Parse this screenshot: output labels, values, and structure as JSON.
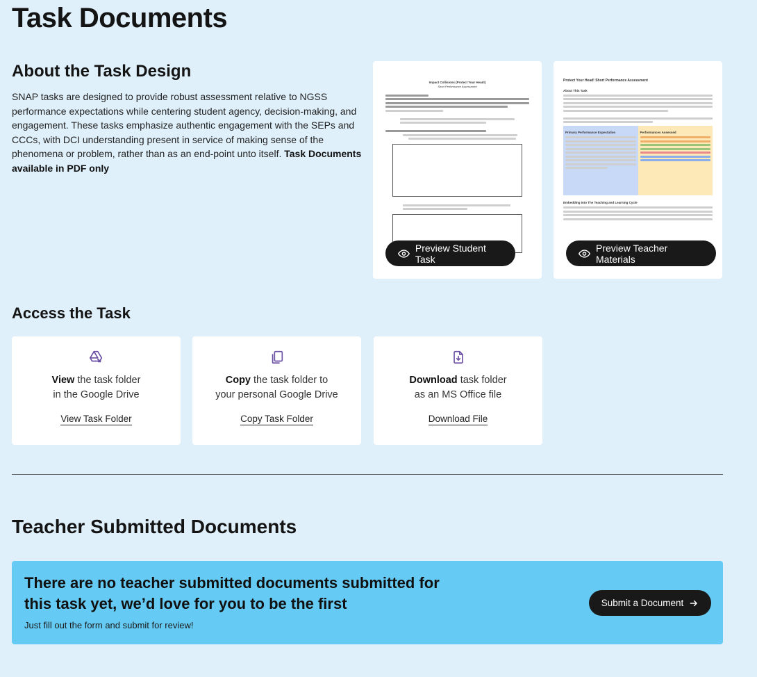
{
  "page": {
    "title": "Task Documents"
  },
  "about": {
    "title": "About the Task Design",
    "body": "SNAP tasks are designed to provide robust assessment relative to NGSS performance expectations while centering student agency, decision-making, and engagement. These tasks emphasize authentic engagement with the SEPs and CCCs, with DCI understanding present in service of making sense of the phenomena or problem, rather than as an end-point unto itself. ",
    "emphasis": "Task Documents available in PDF only"
  },
  "previews": {
    "student": {
      "doc_title": "Impact Collisions (Protect Your Head!)",
      "doc_subtitle": "Short Performance Assessment",
      "button_label": "Preview Student Task",
      "icon": "eye-icon"
    },
    "teacher": {
      "doc_title": "Protect Your Head! Short Performance Assessment",
      "doc_heading1": "About This Task",
      "col1_heading": "Primary Performance Expectation",
      "col2_heading": "Performances Assessed",
      "doc_heading2": "Embedding Into The Teaching and Learning Cycle",
      "button_label": "Preview Teacher Materials",
      "icon": "eye-icon"
    }
  },
  "access": {
    "title": "Access the Task",
    "cards": [
      {
        "icon": "google-drive-icon",
        "bold": "View",
        "line1_rest": " the task folder",
        "line2": "in the Google Drive",
        "link": "View Task Folder"
      },
      {
        "icon": "copy-icon",
        "bold": "Copy",
        "line1_rest": " the task folder to",
        "line2": "your personal Google Drive",
        "link": "Copy Task Folder"
      },
      {
        "icon": "download-file-icon",
        "bold": "Download",
        "line1_rest": " task folder",
        "line2": "as an MS Office file",
        "link": "Download File"
      }
    ]
  },
  "teacher_submitted": {
    "title": "Teacher Submitted Documents",
    "banner_heading": "There are no teacher submitted documents submitted for this task yet, we’d love for you to be the first",
    "banner_sub": "Just fill out the form and submit for review!",
    "submit_label": "Submit a Document",
    "submit_icon": "arrow-right-icon"
  },
  "colors": {
    "page_bg": "#dff0fb",
    "accent_icon": "#6a4fa3",
    "banner_bg": "#66cbf4",
    "button_bg": "#191919"
  }
}
